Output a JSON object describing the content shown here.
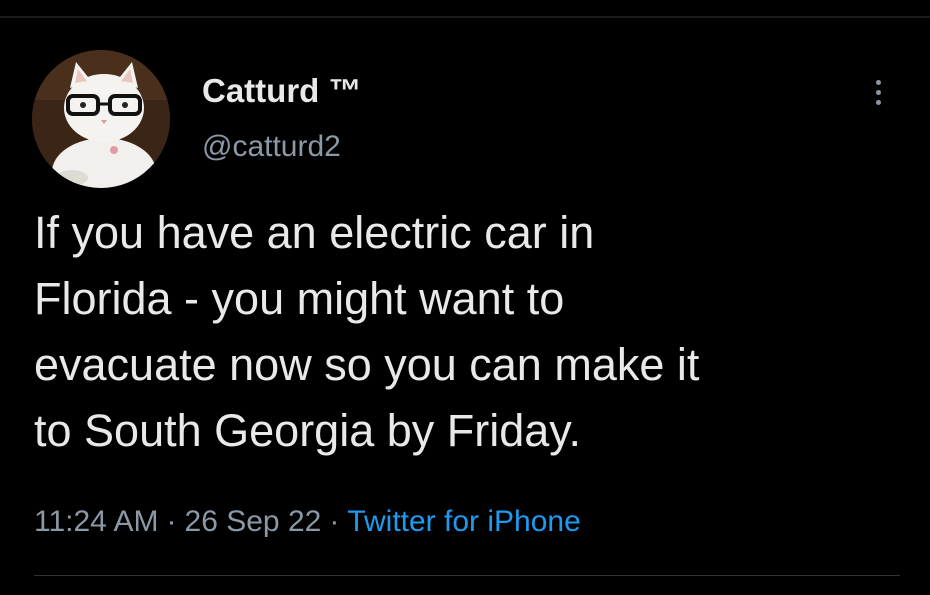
{
  "tweet": {
    "author": {
      "display_name": "Catturd ™",
      "handle": "@catturd2",
      "avatar_icon": "cat-with-glasses-avatar"
    },
    "more_icon": "more-vertical-icon",
    "text_lines": [
      "If you have an electric car in",
      "Florida - you might want to",
      "evacuate now so you can make it",
      "to South Georgia by Friday."
    ],
    "meta": {
      "time": "11:24 AM",
      "separator": "·",
      "date": "26 Sep 22",
      "source": "Twitter for iPhone"
    }
  },
  "colors": {
    "background": "#000000",
    "primary_text": "#e7e9ea",
    "secondary_text": "#8b98a5",
    "link": "#1d9bf0"
  }
}
